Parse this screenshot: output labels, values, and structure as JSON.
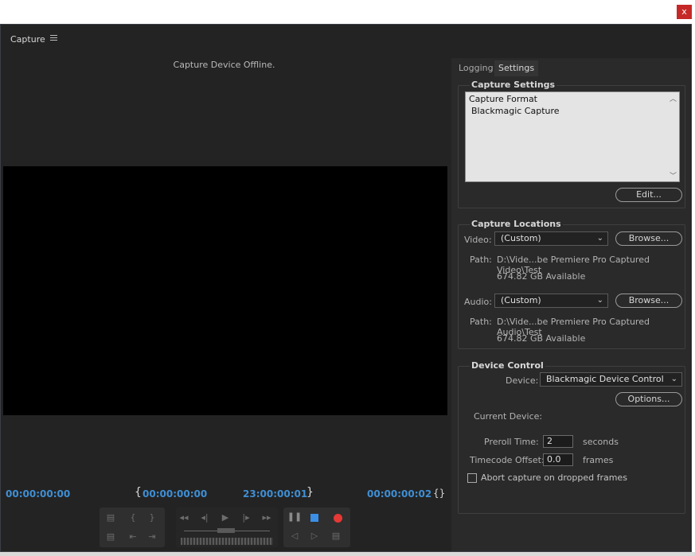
{
  "window": {
    "close_glyph": "x",
    "panel_title": "Capture",
    "menu_icon": "hamburger-icon"
  },
  "monitor": {
    "status": "Capture Device Offline.",
    "timecodes": {
      "current": "00:00:00:00",
      "in_point": "00:00:00:00",
      "out_point": "23:00:00:01",
      "duration": "00:00:00:02"
    }
  },
  "tabs": [
    "Logging",
    "Settings"
  ],
  "capture_settings": {
    "title": "Capture Settings",
    "format_label": "Capture Format",
    "format_value": "Blackmagic Capture",
    "edit_button": "Edit..."
  },
  "capture_locations": {
    "title": "Capture Locations",
    "video_label": "Video:",
    "video_value": "(Custom)",
    "video_browse": "Browse...",
    "video_path_label": "Path:",
    "video_path": "D:\\Vide...be Premiere Pro Captured Video\\Test",
    "video_available": "674.82 GB Available",
    "audio_label": "Audio:",
    "audio_value": "(Custom)",
    "audio_browse": "Browse...",
    "audio_path_label": "Path:",
    "audio_path": "D:\\Vide...be Premiere Pro Captured Audio\\Test",
    "audio_available": "674.82 GB Available"
  },
  "device_control": {
    "title": "Device Control",
    "device_label": "Device:",
    "device_value": "Blackmagic Device Control",
    "options_button": "Options...",
    "current_device_label": "Current Device:",
    "preroll_label": "Preroll Time:",
    "preroll_value": "2",
    "preroll_unit": "seconds",
    "tc_offset_label": "Timecode Offset:",
    "tc_offset_value": "0.0",
    "tc_offset_unit": "frames",
    "abort_label": "Abort capture on dropped frames",
    "abort_checked": false
  },
  "colors": {
    "timecode": "#3f8fd4",
    "record": "#e53935",
    "stop": "#3b8fe6",
    "close": "#c62828"
  }
}
